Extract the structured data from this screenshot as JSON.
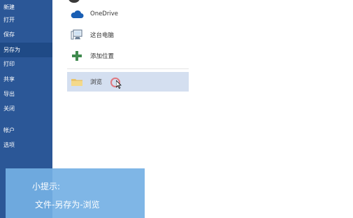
{
  "sidebar": {
    "items": [
      {
        "label": "新建"
      },
      {
        "label": "打开"
      },
      {
        "label": "保存"
      },
      {
        "label": "另存为",
        "active": true
      },
      {
        "label": "打印"
      },
      {
        "label": "共享"
      },
      {
        "label": "导出"
      },
      {
        "label": "关闭"
      },
      {
        "label": "帐户"
      },
      {
        "label": "选项"
      }
    ]
  },
  "places": {
    "onedrive": {
      "label": "OneDrive",
      "icon": "cloud-icon"
    },
    "this_pc": {
      "label": "这台电脑",
      "icon": "computer-icon"
    },
    "add_place": {
      "label": "添加位置",
      "icon": "plus-icon"
    },
    "browse": {
      "label": "浏览",
      "icon": "folder-icon",
      "selected": true
    }
  },
  "tip": {
    "title": "小提示:",
    "text": "文件-另存为-浏览"
  },
  "colors": {
    "sidebar_bg": "#2b5797",
    "sidebar_active": "#1f4a86",
    "selected_row": "#d4dff0",
    "tip_bg": "#74b0e4"
  }
}
